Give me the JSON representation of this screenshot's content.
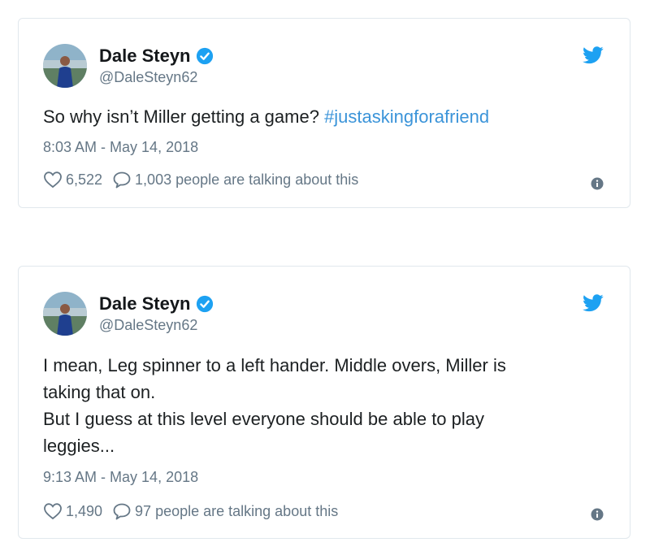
{
  "tweets": [
    {
      "author_name": "Dale Steyn",
      "handle": "@DaleSteyn62",
      "text_plain": "So why isn’t Miller getting a game? ",
      "hashtag": "#justaskingforafriend",
      "timestamp": "8:03 AM - May 14, 2018",
      "likes": "6,522",
      "talking": "1,003 people are talking about this"
    },
    {
      "author_name": "Dale Steyn",
      "handle": "@DaleSteyn62",
      "text_plain": "I mean, Leg spinner to a left hander. Middle overs, Miller is\ntaking that on.\nBut I guess at this level everyone should be able to play\nleggies...",
      "hashtag": "",
      "timestamp": "9:13 AM - May 14, 2018",
      "likes": "1,490",
      "talking": "97 people are talking about this"
    }
  ],
  "icons": {
    "verified": "verified-badge-icon",
    "twitter": "twitter-bird-icon",
    "like": "heart-icon",
    "reply": "speech-bubble-icon",
    "info": "info-icon"
  },
  "colors": {
    "twitter_blue": "#1da1f2",
    "hashtag": "#3b94d9",
    "secondary_text": "#657786"
  }
}
